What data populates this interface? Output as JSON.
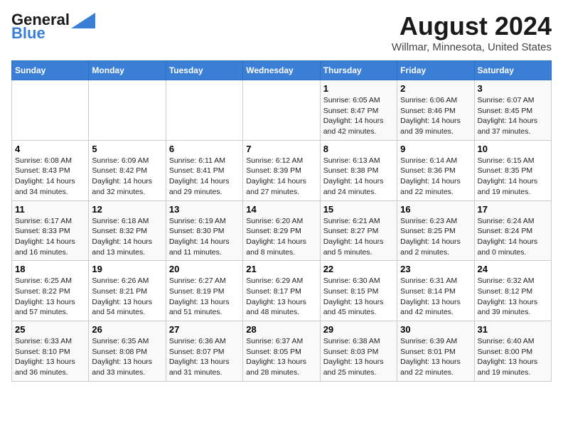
{
  "logo": {
    "text_general": "General",
    "text_blue": "Blue"
  },
  "title": "August 2024",
  "subtitle": "Willmar, Minnesota, United States",
  "days_of_week": [
    "Sunday",
    "Monday",
    "Tuesday",
    "Wednesday",
    "Thursday",
    "Friday",
    "Saturday"
  ],
  "weeks": [
    [
      {
        "day": "",
        "info": ""
      },
      {
        "day": "",
        "info": ""
      },
      {
        "day": "",
        "info": ""
      },
      {
        "day": "",
        "info": ""
      },
      {
        "day": "1",
        "info": "Sunrise: 6:05 AM\nSunset: 8:47 PM\nDaylight: 14 hours\nand 42 minutes."
      },
      {
        "day": "2",
        "info": "Sunrise: 6:06 AM\nSunset: 8:46 PM\nDaylight: 14 hours\nand 39 minutes."
      },
      {
        "day": "3",
        "info": "Sunrise: 6:07 AM\nSunset: 8:45 PM\nDaylight: 14 hours\nand 37 minutes."
      }
    ],
    [
      {
        "day": "4",
        "info": "Sunrise: 6:08 AM\nSunset: 8:43 PM\nDaylight: 14 hours\nand 34 minutes."
      },
      {
        "day": "5",
        "info": "Sunrise: 6:09 AM\nSunset: 8:42 PM\nDaylight: 14 hours\nand 32 minutes."
      },
      {
        "day": "6",
        "info": "Sunrise: 6:11 AM\nSunset: 8:41 PM\nDaylight: 14 hours\nand 29 minutes."
      },
      {
        "day": "7",
        "info": "Sunrise: 6:12 AM\nSunset: 8:39 PM\nDaylight: 14 hours\nand 27 minutes."
      },
      {
        "day": "8",
        "info": "Sunrise: 6:13 AM\nSunset: 8:38 PM\nDaylight: 14 hours\nand 24 minutes."
      },
      {
        "day": "9",
        "info": "Sunrise: 6:14 AM\nSunset: 8:36 PM\nDaylight: 14 hours\nand 22 minutes."
      },
      {
        "day": "10",
        "info": "Sunrise: 6:15 AM\nSunset: 8:35 PM\nDaylight: 14 hours\nand 19 minutes."
      }
    ],
    [
      {
        "day": "11",
        "info": "Sunrise: 6:17 AM\nSunset: 8:33 PM\nDaylight: 14 hours\nand 16 minutes."
      },
      {
        "day": "12",
        "info": "Sunrise: 6:18 AM\nSunset: 8:32 PM\nDaylight: 14 hours\nand 13 minutes."
      },
      {
        "day": "13",
        "info": "Sunrise: 6:19 AM\nSunset: 8:30 PM\nDaylight: 14 hours\nand 11 minutes."
      },
      {
        "day": "14",
        "info": "Sunrise: 6:20 AM\nSunset: 8:29 PM\nDaylight: 14 hours\nand 8 minutes."
      },
      {
        "day": "15",
        "info": "Sunrise: 6:21 AM\nSunset: 8:27 PM\nDaylight: 14 hours\nand 5 minutes."
      },
      {
        "day": "16",
        "info": "Sunrise: 6:23 AM\nSunset: 8:25 PM\nDaylight: 14 hours\nand 2 minutes."
      },
      {
        "day": "17",
        "info": "Sunrise: 6:24 AM\nSunset: 8:24 PM\nDaylight: 14 hours\nand 0 minutes."
      }
    ],
    [
      {
        "day": "18",
        "info": "Sunrise: 6:25 AM\nSunset: 8:22 PM\nDaylight: 13 hours\nand 57 minutes."
      },
      {
        "day": "19",
        "info": "Sunrise: 6:26 AM\nSunset: 8:21 PM\nDaylight: 13 hours\nand 54 minutes."
      },
      {
        "day": "20",
        "info": "Sunrise: 6:27 AM\nSunset: 8:19 PM\nDaylight: 13 hours\nand 51 minutes."
      },
      {
        "day": "21",
        "info": "Sunrise: 6:29 AM\nSunset: 8:17 PM\nDaylight: 13 hours\nand 48 minutes."
      },
      {
        "day": "22",
        "info": "Sunrise: 6:30 AM\nSunset: 8:15 PM\nDaylight: 13 hours\nand 45 minutes."
      },
      {
        "day": "23",
        "info": "Sunrise: 6:31 AM\nSunset: 8:14 PM\nDaylight: 13 hours\nand 42 minutes."
      },
      {
        "day": "24",
        "info": "Sunrise: 6:32 AM\nSunset: 8:12 PM\nDaylight: 13 hours\nand 39 minutes."
      }
    ],
    [
      {
        "day": "25",
        "info": "Sunrise: 6:33 AM\nSunset: 8:10 PM\nDaylight: 13 hours\nand 36 minutes."
      },
      {
        "day": "26",
        "info": "Sunrise: 6:35 AM\nSunset: 8:08 PM\nDaylight: 13 hours\nand 33 minutes."
      },
      {
        "day": "27",
        "info": "Sunrise: 6:36 AM\nSunset: 8:07 PM\nDaylight: 13 hours\nand 31 minutes."
      },
      {
        "day": "28",
        "info": "Sunrise: 6:37 AM\nSunset: 8:05 PM\nDaylight: 13 hours\nand 28 minutes."
      },
      {
        "day": "29",
        "info": "Sunrise: 6:38 AM\nSunset: 8:03 PM\nDaylight: 13 hours\nand 25 minutes."
      },
      {
        "day": "30",
        "info": "Sunrise: 6:39 AM\nSunset: 8:01 PM\nDaylight: 13 hours\nand 22 minutes."
      },
      {
        "day": "31",
        "info": "Sunrise: 6:40 AM\nSunset: 8:00 PM\nDaylight: 13 hours\nand 19 minutes."
      }
    ]
  ]
}
